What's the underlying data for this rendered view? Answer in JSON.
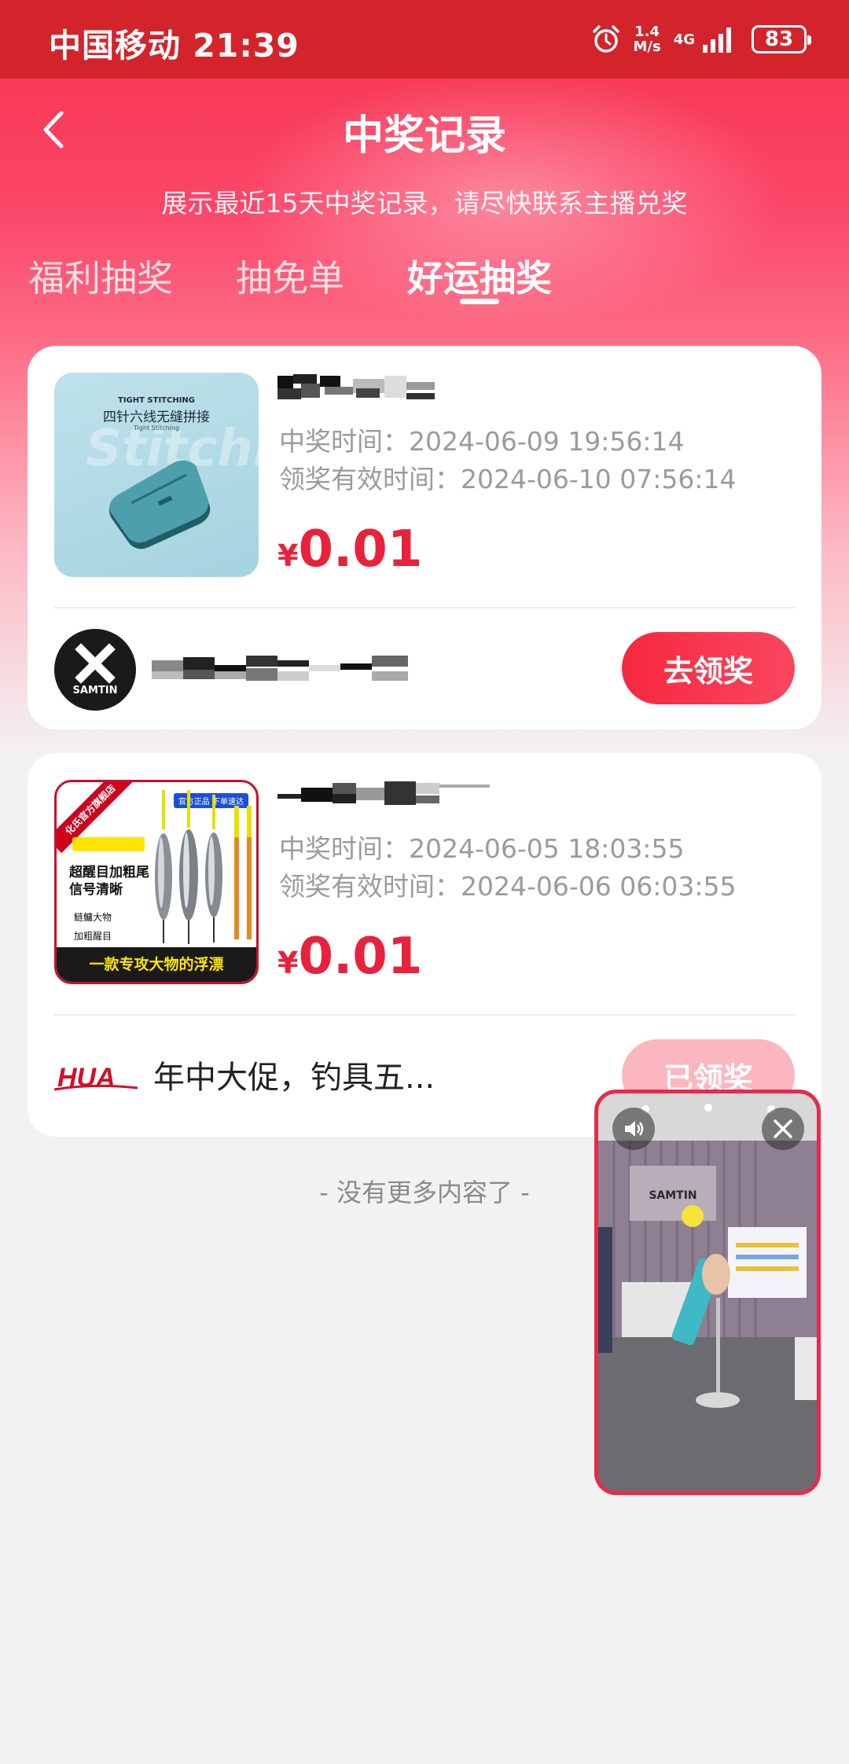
{
  "status_bar": {
    "carrier_time": "中国移动 21:39",
    "net_speed_value": "1.4",
    "net_speed_unit": "M/s",
    "network": "4G",
    "battery": "83"
  },
  "header": {
    "title": "中奖记录",
    "subtitle": "展示最近15天中奖记录，请尽快联系主播兑奖"
  },
  "tabs": [
    {
      "label": "福利抽奖",
      "active": false
    },
    {
      "label": "抽免单",
      "active": false
    },
    {
      "label": "好运抽奖",
      "active": true
    }
  ],
  "records": [
    {
      "thumb_title_en": "TIGHT STITCHING",
      "thumb_title_cn": "四针六线无缝拼接",
      "thumb_sub": "Tight Stitching",
      "thumb_ghost": "Stitching",
      "win_time": "中奖时间：2024-06-09 19:56:14",
      "valid_time": "领奖有效时间：2024-06-10 07:56:14",
      "price_symbol": "¥",
      "price": "0.01",
      "store_logo_text": "SAMTIN",
      "action": "去领奖"
    },
    {
      "thumb_banner": "一款专攻大物的浮漂",
      "thumb_ribbon": "化氏官方旗舰店",
      "thumb_tag": "官方正品 下单速达",
      "thumb_head": "超醒目加粗尾信号清晰",
      "thumb_small1": "鲢鳙大物",
      "thumb_small2": "加粗醒目",
      "win_time": "中奖时间：2024-06-05 18:03:55",
      "valid_time": "领奖有效时间：2024-06-06 06:03:55",
      "price_symbol": "¥",
      "price": "0.01",
      "store_logo_text": "HUA",
      "store_name": "年中大促，钓具五...",
      "action": "已领奖"
    }
  ],
  "footer": {
    "no_more": "- 没有更多内容了 -"
  },
  "live_window": {
    "wall_logo": "SAMTIN"
  },
  "colors": {
    "accent": "#f5283f",
    "price": "#e8223b",
    "status_bar": "#d3242b"
  }
}
